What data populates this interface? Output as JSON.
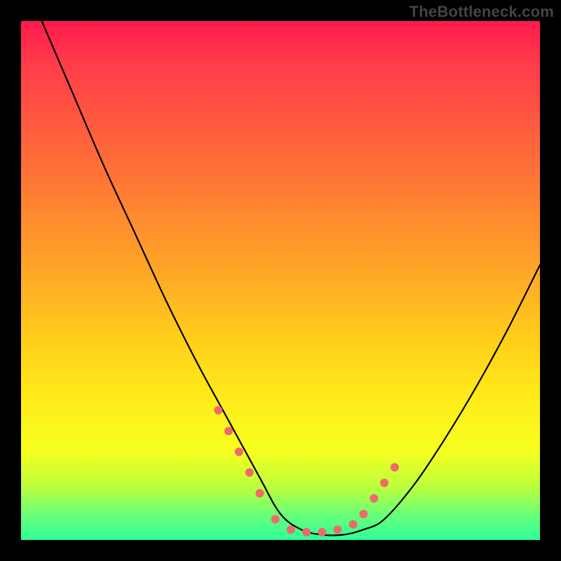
{
  "attribution": "TheBottleneck.com",
  "chart_data": {
    "type": "line",
    "title": "",
    "xlabel": "",
    "ylabel": "",
    "xlim": [
      0,
      1
    ],
    "ylim": [
      0,
      1
    ],
    "series": [
      {
        "name": "bottleneck-curve",
        "x": [
          0.04,
          0.1,
          0.16,
          0.22,
          0.28,
          0.34,
          0.4,
          0.46,
          0.5,
          0.54,
          0.58,
          0.62,
          0.66,
          0.7,
          0.76,
          0.82,
          0.88,
          0.94,
          1.0
        ],
        "y": [
          1.0,
          0.86,
          0.72,
          0.59,
          0.46,
          0.34,
          0.23,
          0.12,
          0.05,
          0.02,
          0.01,
          0.01,
          0.02,
          0.04,
          0.11,
          0.2,
          0.3,
          0.41,
          0.53
        ]
      }
    ],
    "markers": {
      "name": "highlight-dots",
      "color": "#f06a6a",
      "x": [
        0.38,
        0.4,
        0.42,
        0.44,
        0.46,
        0.49,
        0.52,
        0.55,
        0.58,
        0.61,
        0.64,
        0.66,
        0.68,
        0.7,
        0.72
      ],
      "y": [
        0.25,
        0.21,
        0.17,
        0.13,
        0.09,
        0.04,
        0.02,
        0.015,
        0.015,
        0.02,
        0.03,
        0.05,
        0.08,
        0.11,
        0.14
      ]
    }
  }
}
